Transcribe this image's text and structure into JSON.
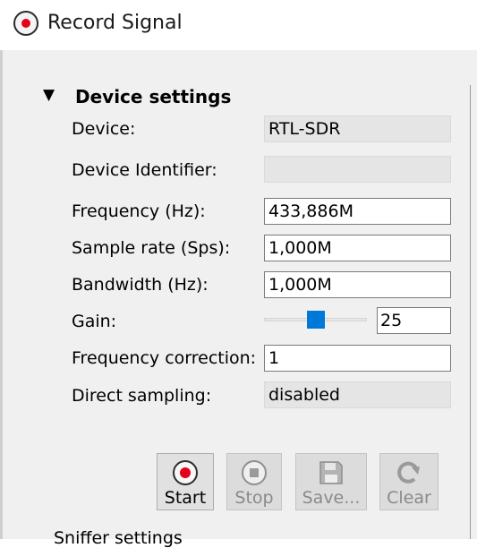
{
  "window": {
    "title": "Record Signal"
  },
  "device_settings": {
    "section_title": "Device settings",
    "section_arrow": "▼",
    "rows": {
      "device": {
        "label": "Device:",
        "value": "RTL-SDR"
      },
      "device_identifier": {
        "label": "Device Identifier:",
        "value": ""
      },
      "frequency": {
        "label": "Frequency (Hz):",
        "value": "433,886M"
      },
      "sample_rate": {
        "label": "Sample rate (Sps):",
        "value": "1,000M"
      },
      "bandwidth": {
        "label": "Bandwidth (Hz):",
        "value": "1,000M"
      },
      "gain": {
        "label": "Gain:",
        "value": "25",
        "slider_fraction": 0.5
      },
      "frequency_correction": {
        "label": "Frequency correction:",
        "value": "1"
      },
      "direct_sampling": {
        "label": "Direct sampling:",
        "value": "disabled"
      }
    }
  },
  "buttons": {
    "start": {
      "label": "Start",
      "icon": "record-icon",
      "enabled": true
    },
    "stop": {
      "label": "Stop",
      "icon": "stop-icon",
      "enabled": false
    },
    "save": {
      "label": "Save...",
      "icon": "save-icon",
      "enabled": false
    },
    "clear": {
      "label": "Clear",
      "icon": "clear-icon",
      "enabled": false
    }
  },
  "next_section": {
    "title": "Sniffer settings"
  },
  "colors": {
    "accent": "#0078d7",
    "record_red": "#e4001b"
  }
}
